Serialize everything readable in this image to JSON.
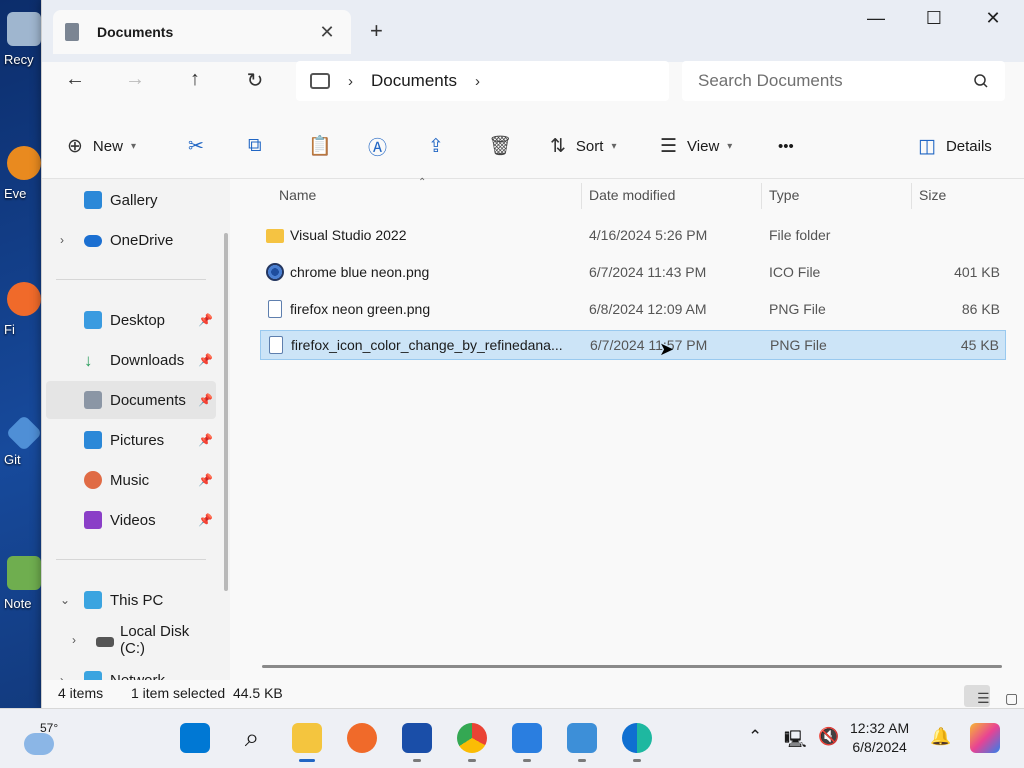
{
  "desktop": {
    "icons": [
      {
        "label": "Recy"
      },
      {
        "label": "Eve"
      },
      {
        "label": "Fi"
      },
      {
        "label": "Git"
      },
      {
        "label": "Note"
      }
    ]
  },
  "window": {
    "tab_title": "Documents",
    "tab_close": "✕",
    "new_tab": "+",
    "controls": {
      "minimize": "—",
      "maximize": "☐",
      "close": "✕"
    }
  },
  "addressbar": {
    "breadcrumb_current": "Documents",
    "breadcrumb_sep": "›",
    "search_placeholder": "Search Documents"
  },
  "toolbar": {
    "new_label": "New",
    "sort_label": "Sort",
    "view_label": "View",
    "more_label": "•••",
    "details_label": "Details"
  },
  "sidebar": {
    "gallery": "Gallery",
    "onedrive": "OneDrive",
    "desktop": "Desktop",
    "downloads": "Downloads",
    "documents": "Documents",
    "pictures": "Pictures",
    "music": "Music",
    "videos": "Videos",
    "this_pc": "This PC",
    "local_disk": "Local Disk (C:)",
    "network": "Network"
  },
  "columns": {
    "name": "Name",
    "date": "Date modified",
    "type": "Type",
    "size": "Size"
  },
  "files": [
    {
      "name": "Visual Studio 2022",
      "date": "4/16/2024 5:26 PM",
      "type": "File folder",
      "size": ""
    },
    {
      "name": "chrome blue neon.png",
      "date": "6/7/2024 11:43 PM",
      "type": "ICO File",
      "size": "401 KB"
    },
    {
      "name": "firefox neon green.png",
      "date": "6/8/2024 12:09 AM",
      "type": "PNG File",
      "size": "86 KB"
    },
    {
      "name": "firefox_icon_color_change_by_refinedana...",
      "date": "6/7/2024 11:57 PM",
      "type": "PNG File",
      "size": "45 KB"
    }
  ],
  "status": {
    "items": "4 items",
    "selected": "1 item selected  44.5 KB"
  },
  "taskbar": {
    "temperature": "57°",
    "time": "12:32 AM",
    "date": "6/8/2024"
  },
  "colors": {
    "accent": "#2166c4",
    "selection": "#cce4f7"
  }
}
